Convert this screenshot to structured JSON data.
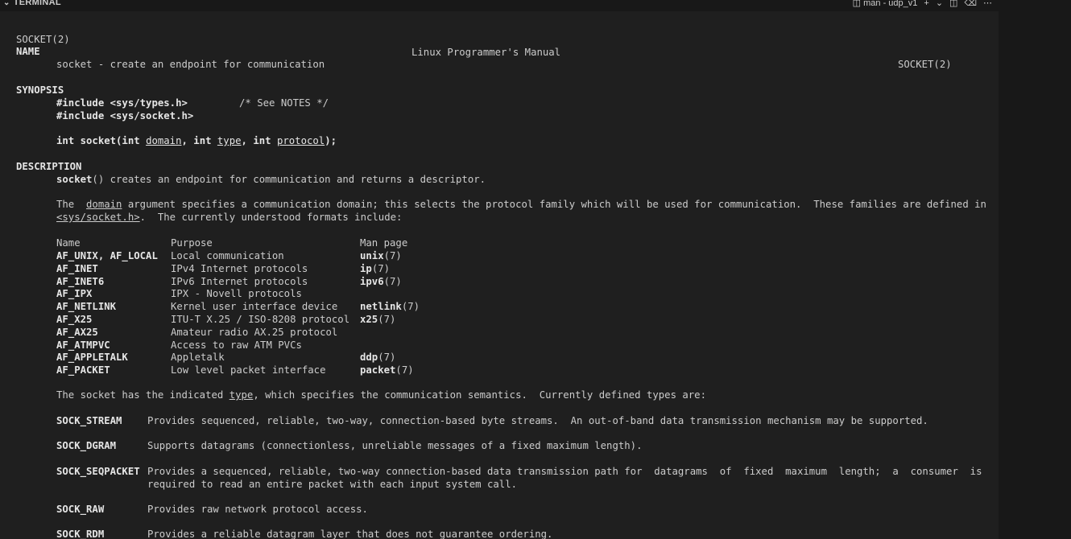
{
  "header": {
    "title": "TERMINAL",
    "session_label": "man - udp_v1"
  },
  "man": {
    "header_left": "SOCKET(2)",
    "header_center": "Linux Programmer's Manual",
    "header_right": "SOCKET(2)",
    "name_heading": "NAME",
    "name_line": "socket - create an endpoint for communication",
    "synopsis_heading": "SYNOPSIS",
    "include1": "#include <sys/types.h>",
    "include1_comment": "/* See NOTES */",
    "include2": "#include <sys/socket.h>",
    "proto_int1": "int socket(int ",
    "proto_domain": "domain",
    "proto_int2": ", int ",
    "proto_type": "type",
    "proto_int3": ", int ",
    "proto_protocol": "protocol",
    "proto_end": ");",
    "description_heading": "DESCRIPTION",
    "desc1_fn": "socket",
    "desc1_rest": "() creates an endpoint for communication and returns a descriptor.",
    "desc2_a": "The  ",
    "desc2_domain": "domain",
    "desc2_b": " argument specifies a communication domain; this selects the protocol family which will be used for communication.  These families are defined in",
    "desc2_header": "<sys/socket.h>",
    "desc2_c": ".  The currently understood formats include:",
    "table_headers": {
      "name": "Name",
      "purpose": "Purpose",
      "manpage": "Man page"
    },
    "families": [
      {
        "name": "AF_UNIX, AF_LOCAL",
        "purpose": "Local communication",
        "page": "unix",
        "sec": "(7)"
      },
      {
        "name": "AF_INET",
        "purpose": "IPv4 Internet protocols",
        "page": "ip",
        "sec": "(7)"
      },
      {
        "name": "AF_INET6",
        "purpose": "IPv6 Internet protocols",
        "page": "ipv6",
        "sec": "(7)"
      },
      {
        "name": "AF_IPX",
        "purpose": "IPX - Novell protocols",
        "page": "",
        "sec": ""
      },
      {
        "name": "AF_NETLINK",
        "purpose": "Kernel user interface device",
        "page": "netlink",
        "sec": "(7)"
      },
      {
        "name": "AF_X25",
        "purpose": "ITU-T X.25 / ISO-8208 protocol",
        "page": "x25",
        "sec": "(7)"
      },
      {
        "name": "AF_AX25",
        "purpose": "Amateur radio AX.25 protocol",
        "page": "",
        "sec": ""
      },
      {
        "name": "AF_ATMPVC",
        "purpose": "Access to raw ATM PVCs",
        "page": "",
        "sec": ""
      },
      {
        "name": "AF_APPLETALK",
        "purpose": "Appletalk",
        "page": "ddp",
        "sec": "(7)"
      },
      {
        "name": "AF_PACKET",
        "purpose": "Low level packet interface",
        "page": "packet",
        "sec": "(7)"
      }
    ],
    "types_intro_a": "The socket has the indicated ",
    "types_intro_type": "type",
    "types_intro_b": ", which specifies the communication semantics.  Currently defined types are:",
    "types": [
      {
        "name": "SOCK_STREAM",
        "desc": "Provides sequenced, reliable, two-way, connection-based byte streams.  An out-of-band data transmission mechanism may be supported."
      },
      {
        "name": "SOCK_DGRAM",
        "desc": "Supports datagrams (connectionless, unreliable messages of a fixed maximum length)."
      },
      {
        "name": "SOCK_SEQPACKET",
        "desc": "Provides a sequenced, reliable, two-way connection-based data transmission path for  datagrams  of  fixed  maximum  length;  a  consumer  is",
        "desc2": "required to read an entire packet with each input system call."
      },
      {
        "name": "SOCK_RAW",
        "desc": "Provides raw network protocol access."
      },
      {
        "name": "SOCK_RDM",
        "desc": "Provides a reliable datagram layer that does not guarantee ordering."
      }
    ]
  }
}
